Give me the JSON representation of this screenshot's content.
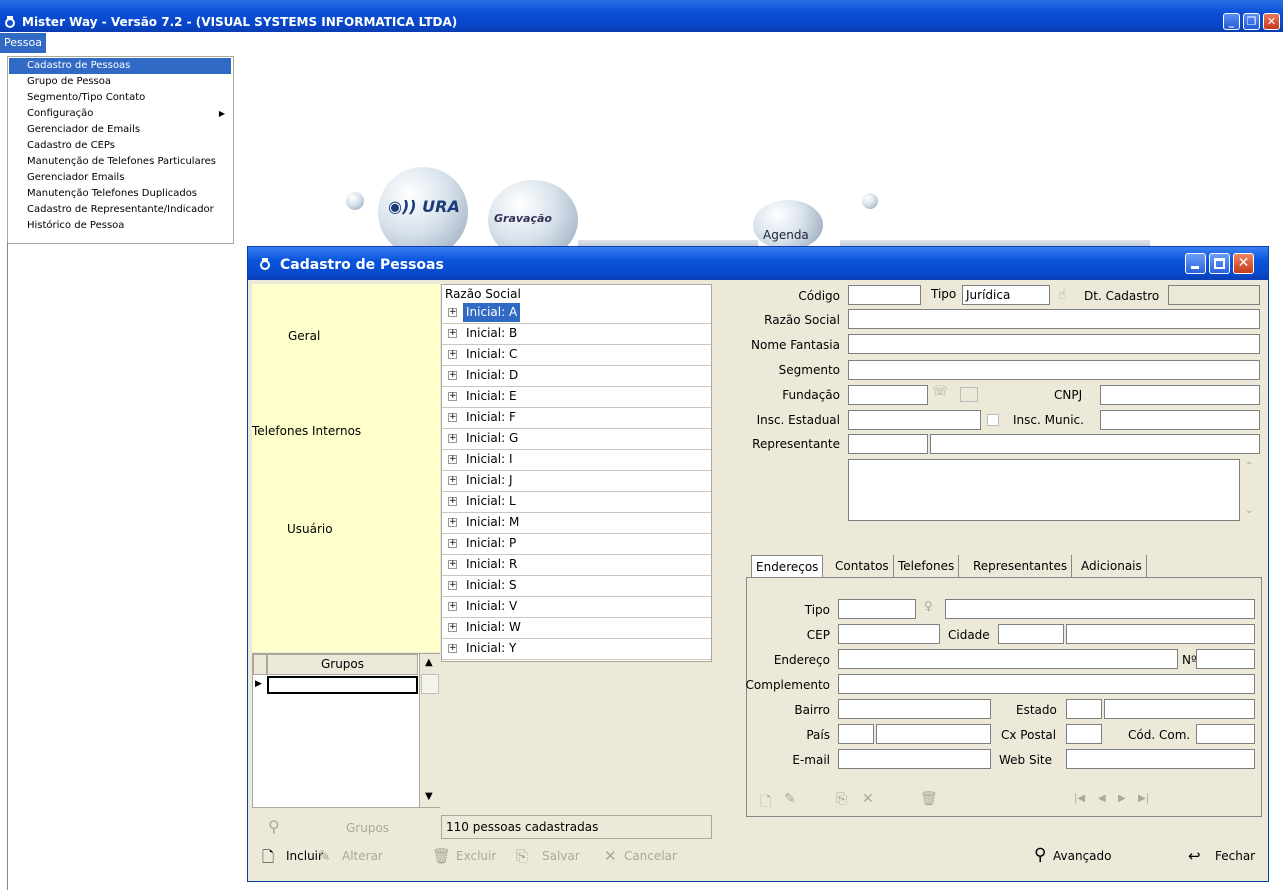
{
  "window": {
    "title": "Mister Way - Versão 7.2 - (VISUAL SYSTEMS INFORMATICA LTDA)"
  },
  "menubar": {
    "pessoa": "Pessoa"
  },
  "menu": {
    "items": [
      {
        "label": "Cadastro de Pessoas"
      },
      {
        "label": "Grupo de Pessoa"
      },
      {
        "label": "Segmento/Tipo Contato"
      },
      {
        "label": "Configuração"
      },
      {
        "label": "Gerenciador de Emails"
      },
      {
        "label": "Cadastro de CEPs"
      },
      {
        "label": "Manutenção de Telefones Particulares"
      },
      {
        "label": "Gerenciador Emails"
      },
      {
        "label": "Manutenção Telefones Duplicados"
      },
      {
        "label": "Cadastro de Representante/Indicador"
      },
      {
        "label": "Histórico de Pessoa"
      }
    ]
  },
  "background": {
    "ura": "URA",
    "gravacao": "Gravação",
    "agenda": "Agenda"
  },
  "child": {
    "title": "Cadastro de Pessoas",
    "left_panel": {
      "geral": "Geral",
      "telefones_internos": "Telefones Internos",
      "usuario": "Usuário",
      "grupos_header": "Grupos",
      "grupos_button": "Grupos"
    },
    "tree": {
      "header": "Razão Social",
      "items": [
        {
          "label": "Inicial: A"
        },
        {
          "label": "Inicial: B"
        },
        {
          "label": "Inicial: C"
        },
        {
          "label": "Inicial: D"
        },
        {
          "label": "Inicial: E"
        },
        {
          "label": "Inicial: F"
        },
        {
          "label": "Inicial: G"
        },
        {
          "label": "Inicial: I"
        },
        {
          "label": "Inicial: J"
        },
        {
          "label": "Inicial: L"
        },
        {
          "label": "Inicial: M"
        },
        {
          "label": "Inicial: P"
        },
        {
          "label": "Inicial: R"
        },
        {
          "label": "Inicial: S"
        },
        {
          "label": "Inicial: V"
        },
        {
          "label": "Inicial: W"
        },
        {
          "label": "Inicial: Y"
        }
      ],
      "count": "110 pessoas cadastradas"
    },
    "form": {
      "codigo": "Código",
      "tipo": "Tipo",
      "tipo_value": "Jurídica",
      "dt_cadastro": "Dt. Cadastro",
      "razao_social": "Razão Social",
      "nome_fantasia": "Nome Fantasia",
      "segmento": "Segmento",
      "fundacao": "Fundação",
      "cnpj": "CNPJ",
      "insc_estadual": "Insc. Estadual",
      "insc_munic": "Insc. Munic.",
      "representante": "Representante"
    },
    "tabs": [
      "Endereços",
      "Contatos",
      "Telefones",
      "Representantes",
      "Adicionais"
    ],
    "address": {
      "tipo": "Tipo",
      "cep": "CEP",
      "cidade": "Cidade",
      "endereco": "Endereço",
      "numero": "Nº",
      "complemento": "Complemento",
      "bairro": "Bairro",
      "estado": "Estado",
      "pais": "País",
      "cx_postal": "Cx Postal",
      "cod_com": "Cód. Com.",
      "email": "E-mail",
      "website": "Web Site"
    },
    "toolbar": {
      "incluir": "Incluir",
      "alterar": "Alterar",
      "excluir": "Excluir",
      "salvar": "Salvar",
      "cancelar": "Cancelar",
      "avancado": "Avançado",
      "fechar": "Fechar"
    }
  }
}
